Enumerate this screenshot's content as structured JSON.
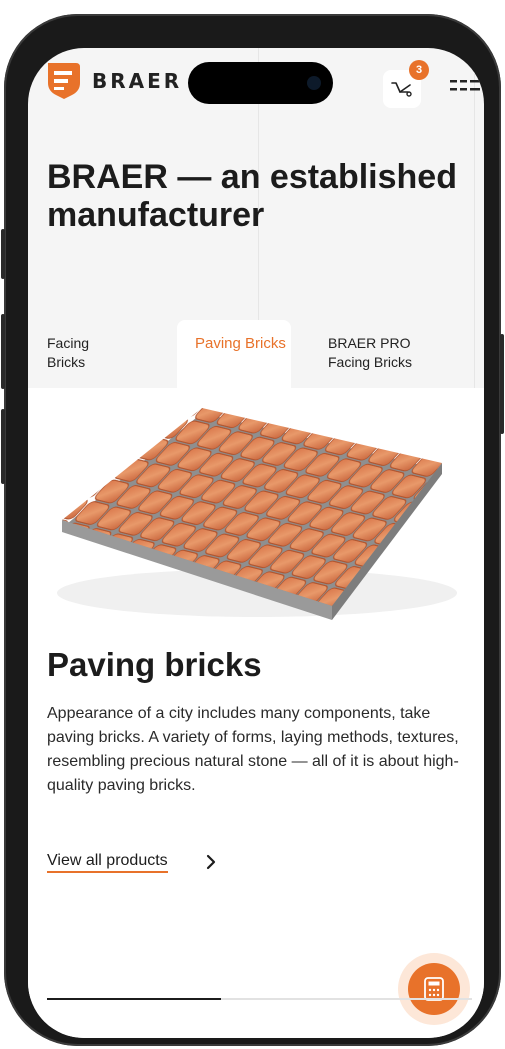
{
  "brand": {
    "name": "BRAER",
    "accent": "#e8722a"
  },
  "header": {
    "cart_count": "3"
  },
  "hero": {
    "headline": "BRAER — an established manufacturer"
  },
  "tabs": [
    {
      "label": "Facing Bricks",
      "active": false
    },
    {
      "label": "Paving Bricks",
      "active": true
    },
    {
      "label": "BRAER PRO Facing Bricks",
      "active": false
    }
  ],
  "product": {
    "title": "Paving bricks",
    "description": "Appearance of a city includes many components, take paving bricks. A variety of forms, laying methods, textures, resembling precious natural stone — all of it is about high-quality paving bricks.",
    "link_label": "View all products"
  },
  "carousel": {
    "progress": 0.41
  },
  "icons": [
    "braer-logo-icon",
    "cart-icon",
    "menu-icon",
    "chevron-right-icon",
    "calculator-icon"
  ]
}
